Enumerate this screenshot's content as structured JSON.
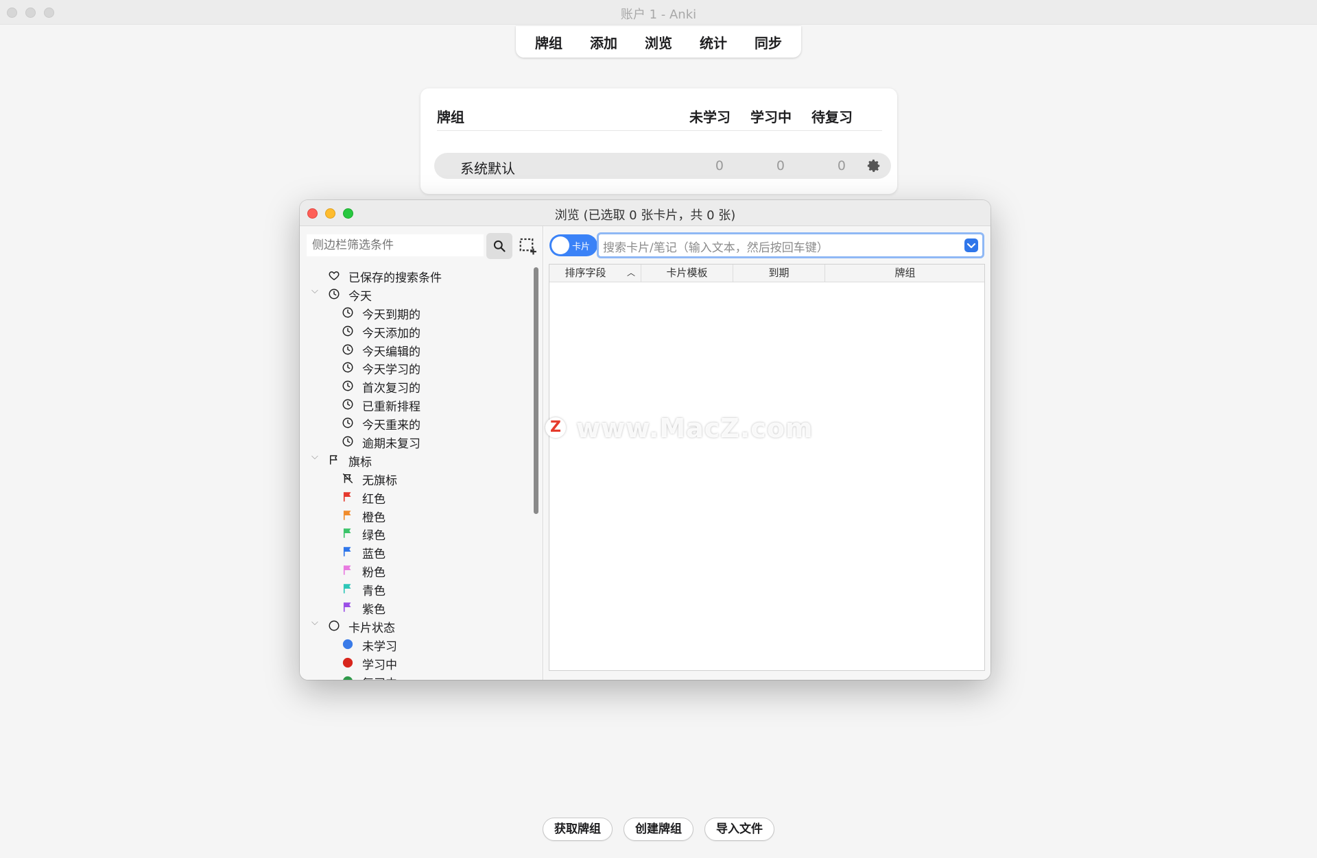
{
  "window": {
    "title": "账户 1 - Anki"
  },
  "toolbar": [
    "牌组",
    "添加",
    "浏览",
    "统计",
    "同步"
  ],
  "deck_panel": {
    "headers": {
      "deck": "牌组",
      "new": "未学习",
      "learning": "学习中",
      "due": "待复习"
    },
    "rows": [
      {
        "name": "系统默认",
        "new": "0",
        "learning": "0",
        "due": "0"
      }
    ]
  },
  "browse": {
    "title": "浏览 (已选取 0 张卡片，共 0 张)",
    "sidebar_search_placeholder": "侧边栏筛选条件",
    "toggle_label": "卡片",
    "search_placeholder": "搜索卡片/笔记（输入文本，然后按回车键）",
    "columns": [
      "排序字段",
      "卡片模板",
      "到期",
      "牌组"
    ],
    "tree": [
      {
        "label": "已保存的搜索条件",
        "icon": "heart-icon",
        "level": 0
      },
      {
        "label": "今天",
        "icon": "clock-icon",
        "level": 0,
        "expanded": true
      },
      {
        "label": "今天到期的",
        "icon": "clock-icon",
        "level": 1
      },
      {
        "label": "今天添加的",
        "icon": "clock-icon",
        "level": 1
      },
      {
        "label": "今天编辑的",
        "icon": "clock-icon",
        "level": 1
      },
      {
        "label": "今天学习的",
        "icon": "clock-icon",
        "level": 1
      },
      {
        "label": "首次复习的",
        "icon": "clock-icon",
        "level": 1
      },
      {
        "label": "已重新排程",
        "icon": "clock-icon",
        "level": 1
      },
      {
        "label": "今天重来的",
        "icon": "clock-icon",
        "level": 1
      },
      {
        "label": "逾期未复习",
        "icon": "clock-icon",
        "level": 1
      },
      {
        "label": "旗标",
        "icon": "flag-outline-icon",
        "level": 0,
        "expanded": true
      },
      {
        "label": "无旗标",
        "icon": "no-flag-icon",
        "level": 1
      },
      {
        "label": "红色",
        "icon": "flag-icon",
        "color": "#e5392e",
        "level": 1
      },
      {
        "label": "橙色",
        "icon": "flag-icon",
        "color": "#f08c2c",
        "level": 1
      },
      {
        "label": "绿色",
        "icon": "flag-icon",
        "color": "#3cc46a",
        "level": 1
      },
      {
        "label": "蓝色",
        "icon": "flag-icon",
        "color": "#2f76ea",
        "level": 1
      },
      {
        "label": "粉色",
        "icon": "flag-icon",
        "color": "#e87ae0",
        "level": 1
      },
      {
        "label": "青色",
        "icon": "flag-icon",
        "color": "#2ec7b8",
        "level": 1
      },
      {
        "label": "紫色",
        "icon": "flag-icon",
        "color": "#9a4fe6",
        "level": 1
      },
      {
        "label": "卡片状态",
        "icon": "circle-outline-icon",
        "level": 0,
        "expanded": true
      },
      {
        "label": "未学习",
        "icon": "dot-icon",
        "color": "#3a7be8",
        "level": 1
      },
      {
        "label": "学习中",
        "icon": "dot-icon",
        "color": "#d8261d",
        "level": 1
      },
      {
        "label": "复习中",
        "icon": "dot-icon",
        "color": "#2f9a4a",
        "level": 1
      }
    ]
  },
  "watermark": {
    "logo": "Z",
    "text": "www.MacZ.com"
  },
  "bottom_buttons": [
    "获取牌组",
    "创建牌组",
    "导入文件"
  ]
}
